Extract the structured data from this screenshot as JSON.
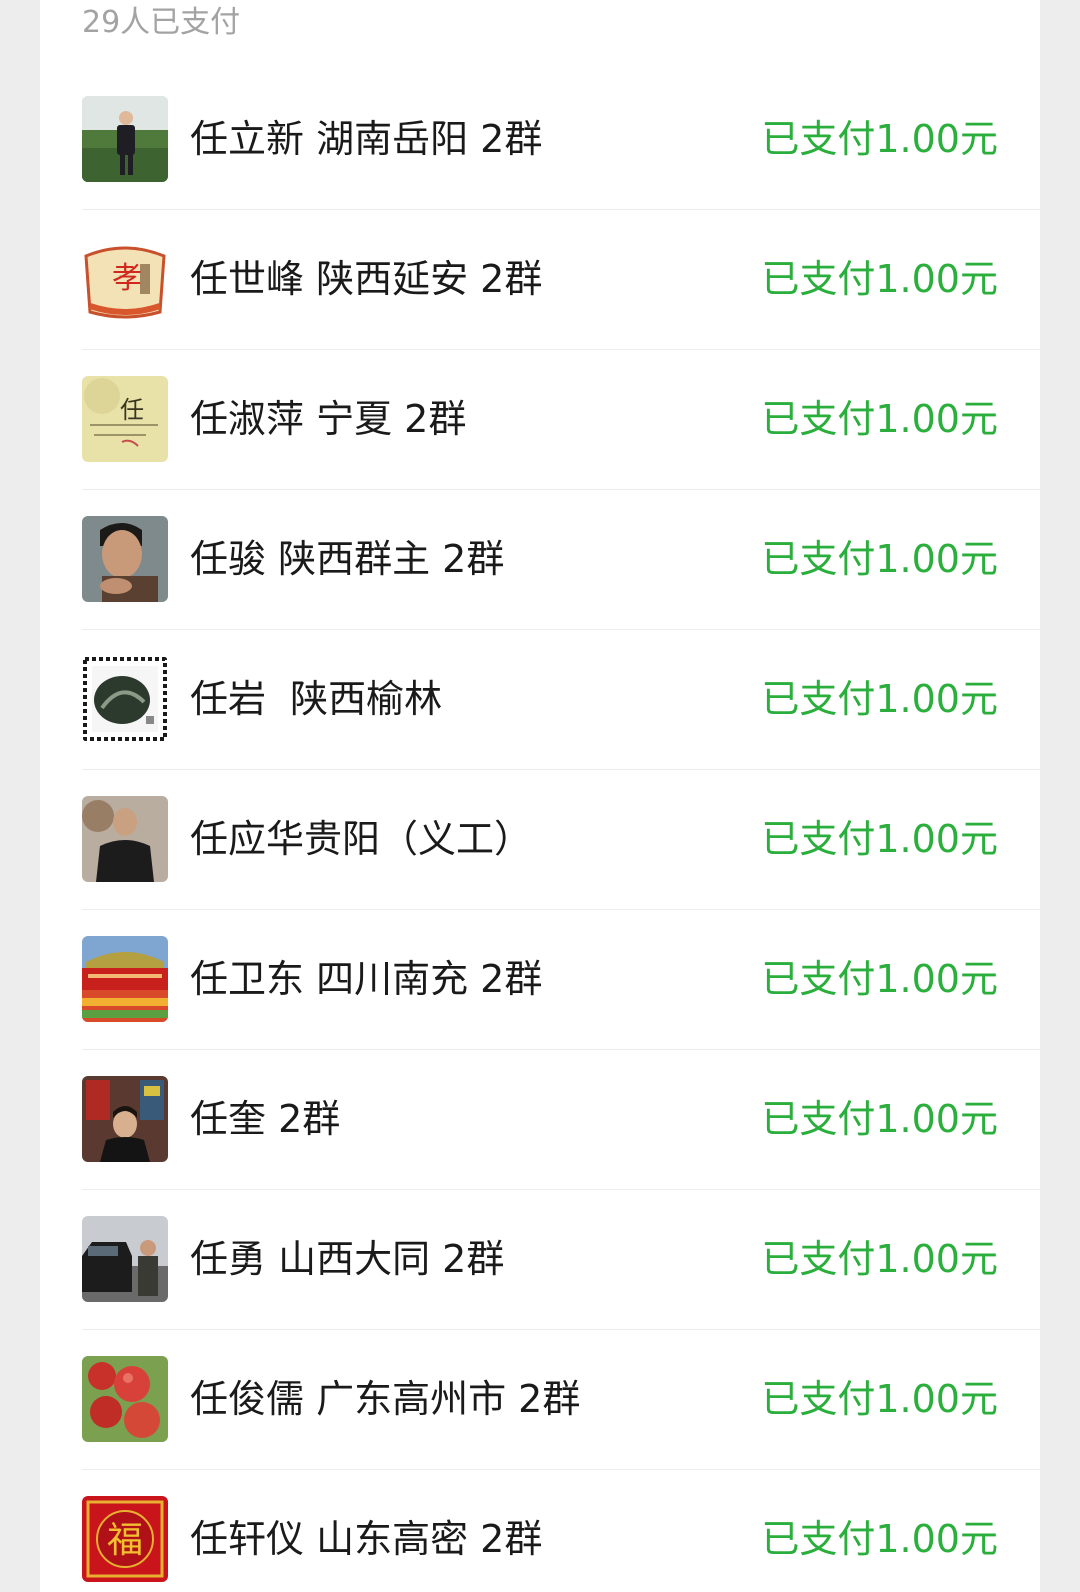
{
  "header": {
    "paid_count": "29人已支付"
  },
  "payers": [
    {
      "name": "任立新 湖南岳阳 2群",
      "status": "已支付1.00元",
      "avatar_icon": "man-field-photo-icon"
    },
    {
      "name": "任世峰 陕西延安 2群",
      "status": "已支付1.00元",
      "avatar_icon": "xiao-character-fan-icon"
    },
    {
      "name": "任淑萍 宁夏 2群",
      "status": "已支付1.00元",
      "avatar_icon": "ren-calligraphy-icon"
    },
    {
      "name": "任骏 陕西群主 2群",
      "status": "已支付1.00元",
      "avatar_icon": "man-portrait-icon"
    },
    {
      "name": "任岩  陕西榆林",
      "status": "已支付1.00元",
      "avatar_icon": "stamp-landscape-icon"
    },
    {
      "name": "任应华贵阳（义工）",
      "status": "已支付1.00元",
      "avatar_icon": "man-indoor-photo-icon"
    },
    {
      "name": "任卫东 四川南充 2群",
      "status": "已支付1.00元",
      "avatar_icon": "banner-flowers-photo-icon"
    },
    {
      "name": "任奎 2群",
      "status": "已支付1.00元",
      "avatar_icon": "woman-shop-photo-icon"
    },
    {
      "name": "任勇 山西大同 2群",
      "status": "已支付1.00元",
      "avatar_icon": "man-car-photo-icon"
    },
    {
      "name": "任俊儒 广东高州市 2群",
      "status": "已支付1.00元",
      "avatar_icon": "apples-photo-icon"
    },
    {
      "name": "任轩仪 山东高密 2群",
      "status": "已支付1.00元",
      "avatar_icon": "fu-character-icon"
    }
  ],
  "avatar_texts": {
    "xiao": "孝",
    "ren": "任",
    "fu": "福"
  },
  "colors": {
    "paid_green": "#2aae3c",
    "name_text": "#1a1a1a",
    "muted_text": "#a3a3a3",
    "background": "#ededed"
  }
}
